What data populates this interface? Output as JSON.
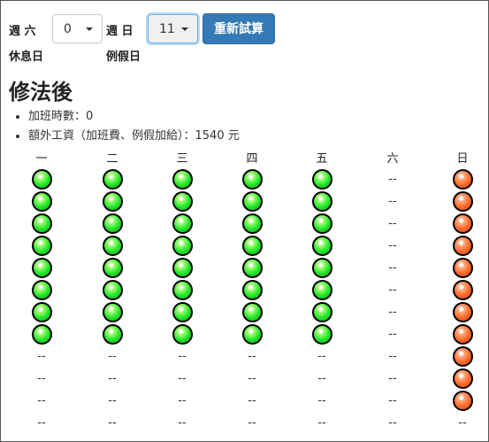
{
  "controls": {
    "rest_day_label": "週 六",
    "rest_day_caption": "休息日",
    "rest_day_value": "0",
    "off_day_label": "週 日",
    "off_day_caption": "例假日",
    "off_day_value": "11",
    "recalc_button": "重新試算"
  },
  "result": {
    "heading": "修法後",
    "overtime_hours": "加班時數：0",
    "extra_wage": "額外工資（加班費、例假加給）：1540 元"
  },
  "calendar": {
    "days": [
      {
        "label": "一",
        "cells": [
          "green",
          "green",
          "green",
          "green",
          "green",
          "green",
          "green",
          "green",
          "--",
          "--",
          "--",
          "--"
        ]
      },
      {
        "label": "二",
        "cells": [
          "green",
          "green",
          "green",
          "green",
          "green",
          "green",
          "green",
          "green",
          "--",
          "--",
          "--",
          "--"
        ]
      },
      {
        "label": "三",
        "cells": [
          "green",
          "green",
          "green",
          "green",
          "green",
          "green",
          "green",
          "green",
          "--",
          "--",
          "--",
          "--"
        ]
      },
      {
        "label": "四",
        "cells": [
          "green",
          "green",
          "green",
          "green",
          "green",
          "green",
          "green",
          "green",
          "--",
          "--",
          "--",
          "--"
        ]
      },
      {
        "label": "五",
        "cells": [
          "green",
          "green",
          "green",
          "green",
          "green",
          "green",
          "green",
          "green",
          "--",
          "--",
          "--",
          "--"
        ]
      },
      {
        "label": "六",
        "cells": [
          "--",
          "--",
          "--",
          "--",
          "--",
          "--",
          "--",
          "--",
          "--",
          "--",
          "--",
          "--"
        ]
      },
      {
        "label": "日",
        "cells": [
          "orange",
          "orange",
          "orange",
          "orange",
          "orange",
          "orange",
          "orange",
          "orange",
          "orange",
          "orange",
          "orange",
          "--"
        ]
      }
    ],
    "colors": {
      "worked_weekday": "#22e82a",
      "worked_off_day": "#ff6a2a"
    }
  }
}
